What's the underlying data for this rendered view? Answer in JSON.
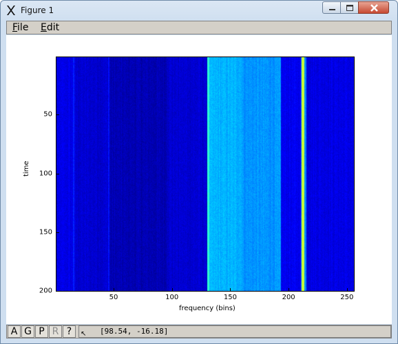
{
  "window": {
    "title": "Figure 1"
  },
  "menubar": {
    "file_label": "File",
    "file_mnemonic": "F",
    "file_rest": "ile",
    "edit_label": "Edit",
    "edit_mnemonic": "E",
    "edit_rest": "dit"
  },
  "toolbar": {
    "buttons": [
      {
        "label": "A",
        "enabled": true
      },
      {
        "label": "G",
        "enabled": true
      },
      {
        "label": "P",
        "enabled": true
      },
      {
        "label": "R",
        "enabled": false
      },
      {
        "label": "?",
        "enabled": true
      }
    ],
    "status": "[98.54, -16.18]"
  },
  "chart_data": {
    "type": "heatmap",
    "title": "",
    "xlabel": "frequency (bins)",
    "ylabel": "time",
    "xlim": [
      1,
      256
    ],
    "ylim": [
      200,
      1
    ],
    "y_inverted": true,
    "x_ticks": [
      50,
      100,
      150,
      200,
      250
    ],
    "y_ticks": [
      50,
      100,
      150,
      200
    ],
    "colormap": "jet",
    "grid": false,
    "column_profile": [
      {
        "x_start": 1,
        "x_end": 15,
        "level": 0.1
      },
      {
        "x_start": 15,
        "x_end": 16,
        "level": 0.16
      },
      {
        "x_start": 16,
        "x_end": 45,
        "level": 0.08
      },
      {
        "x_start": 45,
        "x_end": 46,
        "level": 0.14
      },
      {
        "x_start": 46,
        "x_end": 95,
        "level": 0.05
      },
      {
        "x_start": 95,
        "x_end": 130,
        "level": 0.08
      },
      {
        "x_start": 130,
        "x_end": 132,
        "level": 0.42
      },
      {
        "x_start": 132,
        "x_end": 160,
        "level": 0.3
      },
      {
        "x_start": 160,
        "x_end": 193,
        "level": 0.27
      },
      {
        "x_start": 193,
        "x_end": 210,
        "level": 0.11
      },
      {
        "x_start": 210,
        "x_end": 211,
        "level": 0.22
      },
      {
        "x_start": 211,
        "x_end": 213,
        "level": 0.58
      },
      {
        "x_start": 213,
        "x_end": 215,
        "level": 0.25
      },
      {
        "x_start": 215,
        "x_end": 256,
        "level": 0.1
      }
    ],
    "colors": {
      "background": "#00008f",
      "dark": "#00007f",
      "mid": "#0060ff",
      "cyan": "#00ffff",
      "yellow": "#ffff00"
    }
  }
}
